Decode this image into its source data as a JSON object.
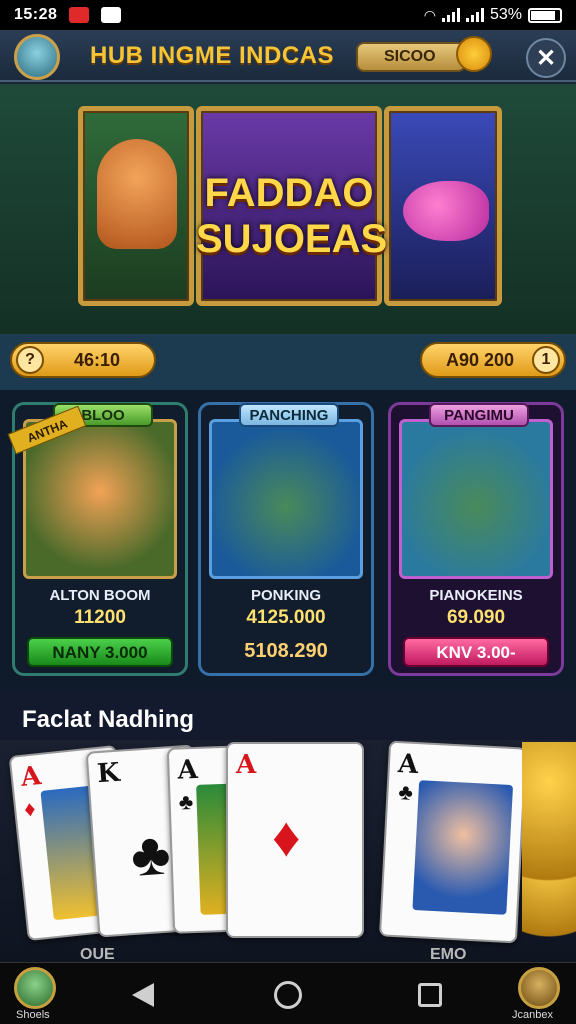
{
  "status_bar": {
    "time": "15:28",
    "battery": "53%"
  },
  "header": {
    "title": "HUB INGME INDCAS",
    "coin_value": "SICOO",
    "close_symbol": "✕"
  },
  "banner": {
    "line1": "FADDAO",
    "line2": "SUJOEAS"
  },
  "balances": {
    "left_value": "46:10",
    "left_badge": "?",
    "right_value": "A90 200",
    "right_badge": "1"
  },
  "games": [
    {
      "tag": "BLOO",
      "ribbon": "ANTHA",
      "name": "ALTON BOOM",
      "value": "11200",
      "button": "NANY 3.000",
      "button_color": "#2aa02a"
    },
    {
      "tag": "PANCHING",
      "name": "PONKING",
      "value": "4125.000",
      "button": "5108.290"
    },
    {
      "tag": "PANGIMU",
      "name": "PIANOKEINS",
      "value": "69.090",
      "button": "KNV 3.00-",
      "button_color": "#e02070"
    }
  ],
  "section": {
    "title": "Faclat Nadhing"
  },
  "cards": [
    {
      "rank": "A",
      "suit": "♦",
      "color": "red"
    },
    {
      "rank": "K",
      "suit": "♣",
      "color": "black"
    },
    {
      "rank": "A",
      "suit": "♣",
      "color": "black"
    },
    {
      "rank": "A",
      "suit": "♦",
      "color": "red"
    },
    {
      "rank": "A",
      "suit": "♣",
      "color": "black"
    }
  ],
  "below_cards": {
    "left": "OUE",
    "right": "EMO"
  },
  "bottom_nav": {
    "left_label": "Shoels",
    "right_label": "Jcanbex"
  }
}
